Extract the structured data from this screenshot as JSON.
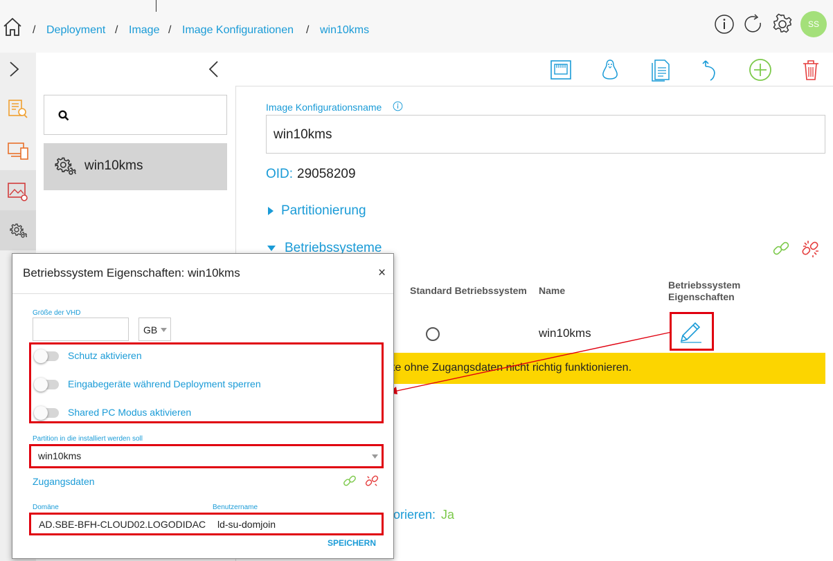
{
  "breadcrumb": {
    "items": [
      "Deployment",
      "Image",
      "Image Konfigurationen",
      "win10kms"
    ],
    "separator": "/"
  },
  "header": {
    "avatar_initials": "SS",
    "icons": [
      "info-icon",
      "refresh-icon",
      "settings-gear-icon"
    ]
  },
  "search": {
    "placeholder": ""
  },
  "list": {
    "items": [
      {
        "label": "win10kms"
      }
    ]
  },
  "detail": {
    "name_label": "Image Konfigurationsname",
    "name_value": "win10kms",
    "oid_label": "OID:",
    "oid_value": "29058209",
    "section_partitioning": "Partitionierung",
    "section_os": "Betriebssysteme",
    "table": {
      "headers": [
        "Standard Betriebssystem",
        "Name",
        "Betriebssystem Eigenschaften"
      ],
      "row": {
        "name": "win10kms"
      }
    },
    "warning_text": "te ohne Zugangsdaten nicht richtig funktionieren.",
    "partial_label": "orieren:",
    "partial_value": "Ja"
  },
  "modal": {
    "title": "Betriebssystem Eigenschaften: win10kms",
    "close": "×",
    "vhd_label": "Größe der VHD",
    "vhd_value": "",
    "vhd_unit": "GB",
    "toggles": [
      "Schutz aktivieren",
      "Eingabegeräte während Deployment sperren",
      "Shared PC Modus aktivieren"
    ],
    "partition_label": "Partition in die installiert werden soll",
    "partition_value": "win10kms",
    "credentials_label": "Zugangsdaten",
    "domain_label": "Domäne",
    "domain_value": "AD.SBE-BFH-CLOUD02.LOGODIDAC",
    "user_label": "Benutzername",
    "user_value": "ld-su-domjoin",
    "save": "SPEICHERN"
  },
  "colors": {
    "accent": "#1a9bd7",
    "warning": "#fcd500",
    "highlight": "#e0000f",
    "success": "#7cc94a",
    "danger": "#e53c3c"
  }
}
